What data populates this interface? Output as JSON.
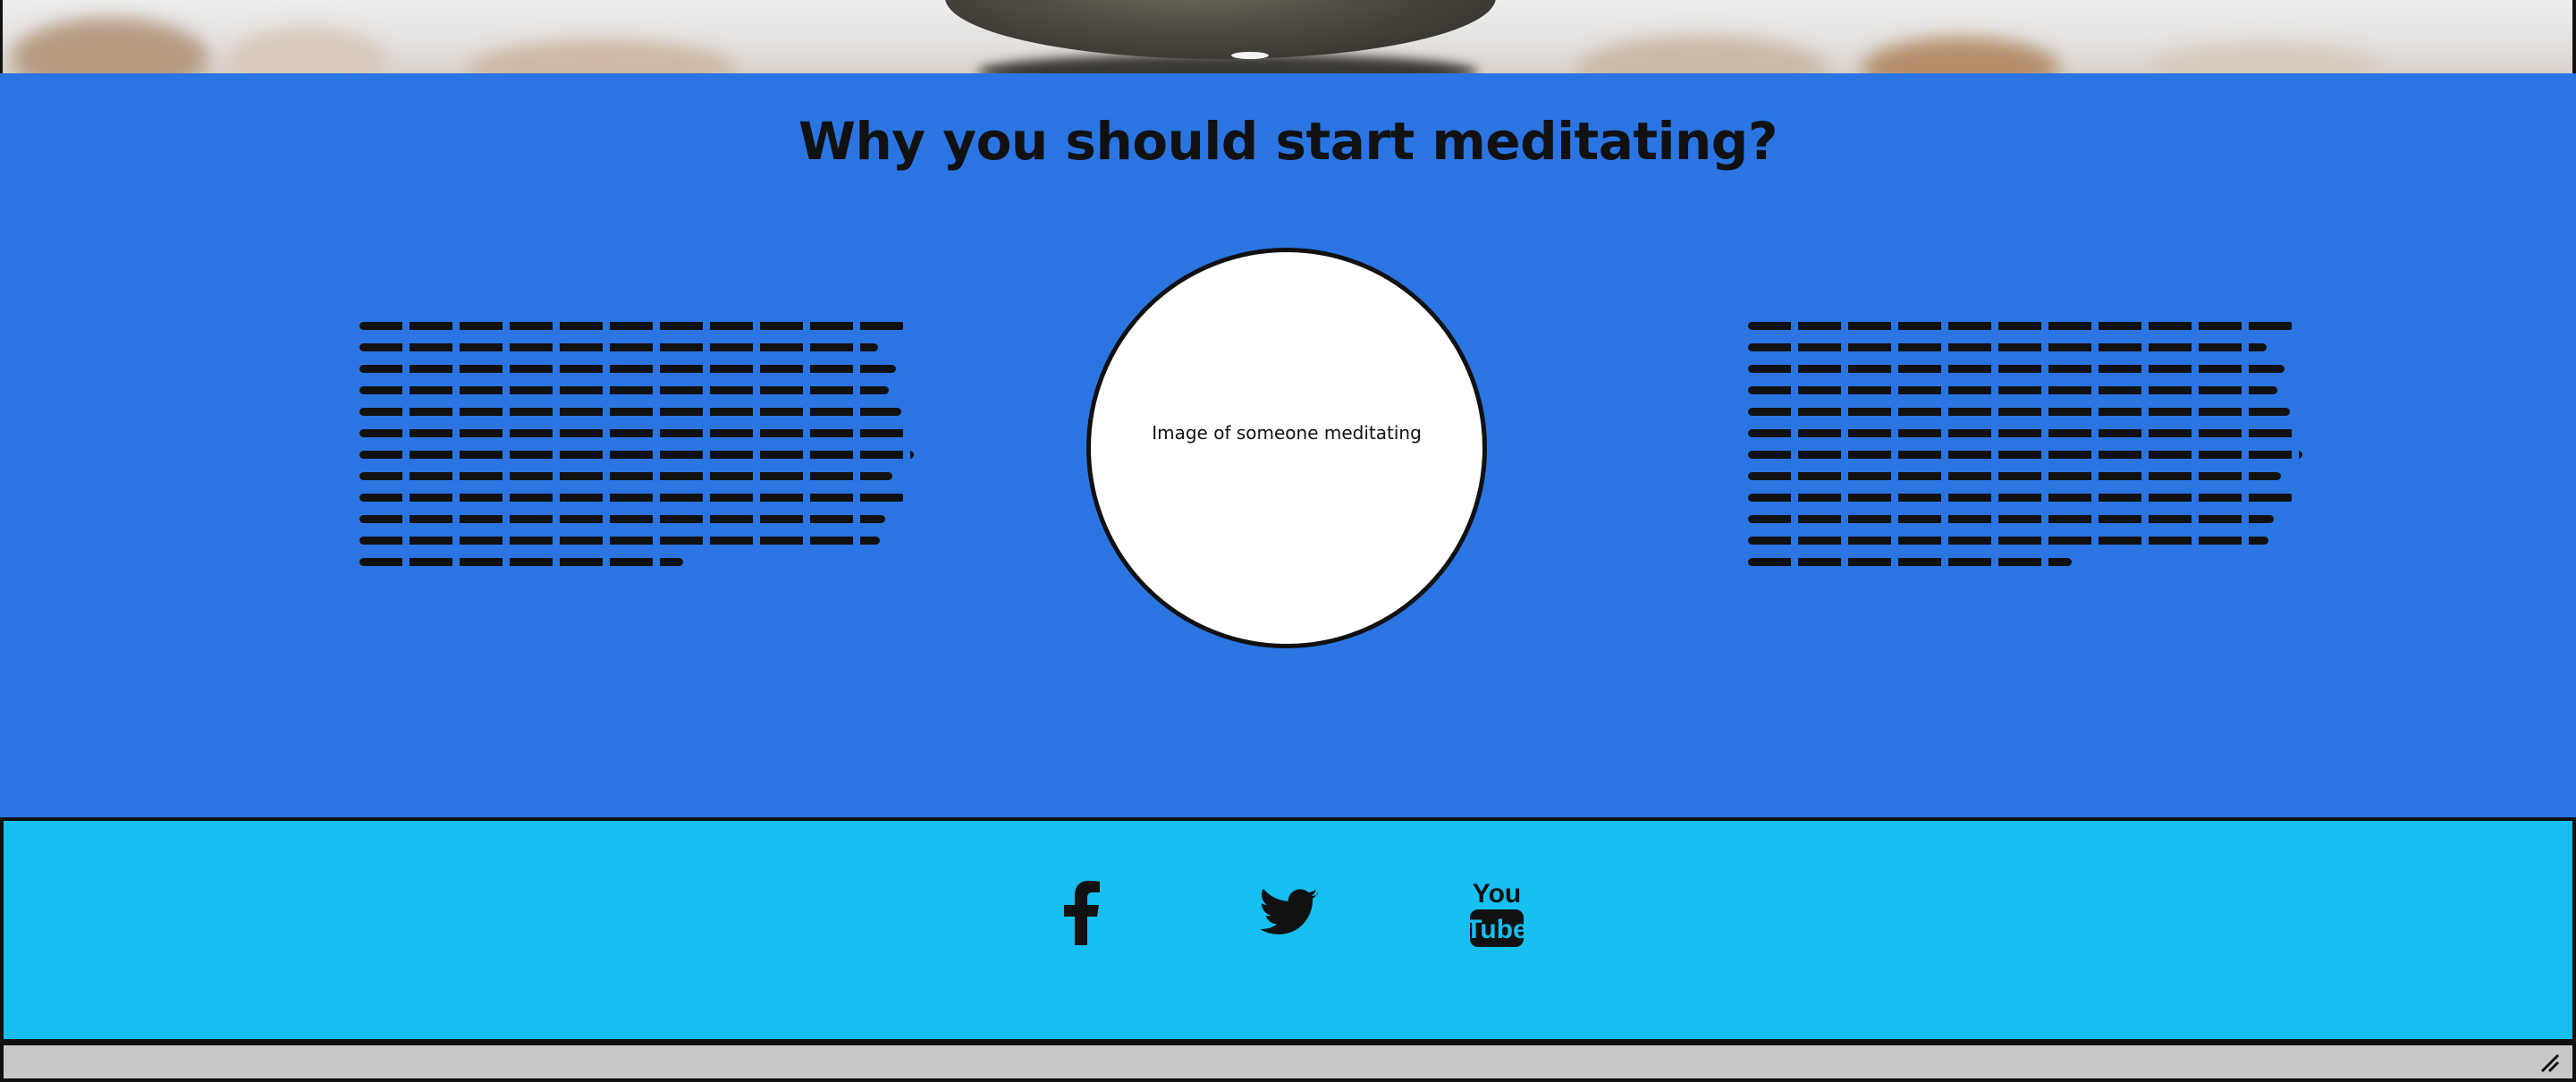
{
  "section": {
    "title": "Why you should start meditating?",
    "image_placeholder": "Image of someone meditating"
  },
  "footer": {
    "social_icons": [
      "facebook-icon",
      "twitter-icon",
      "youtube-icon"
    ],
    "youtube_text_top": "You",
    "youtube_text_bottom": "Tube"
  },
  "colors": {
    "section_bg": "#2b75e3",
    "footer_bg": "#16bff0",
    "bottom_bar_bg": "#c8c8c8",
    "ink": "#111111"
  }
}
